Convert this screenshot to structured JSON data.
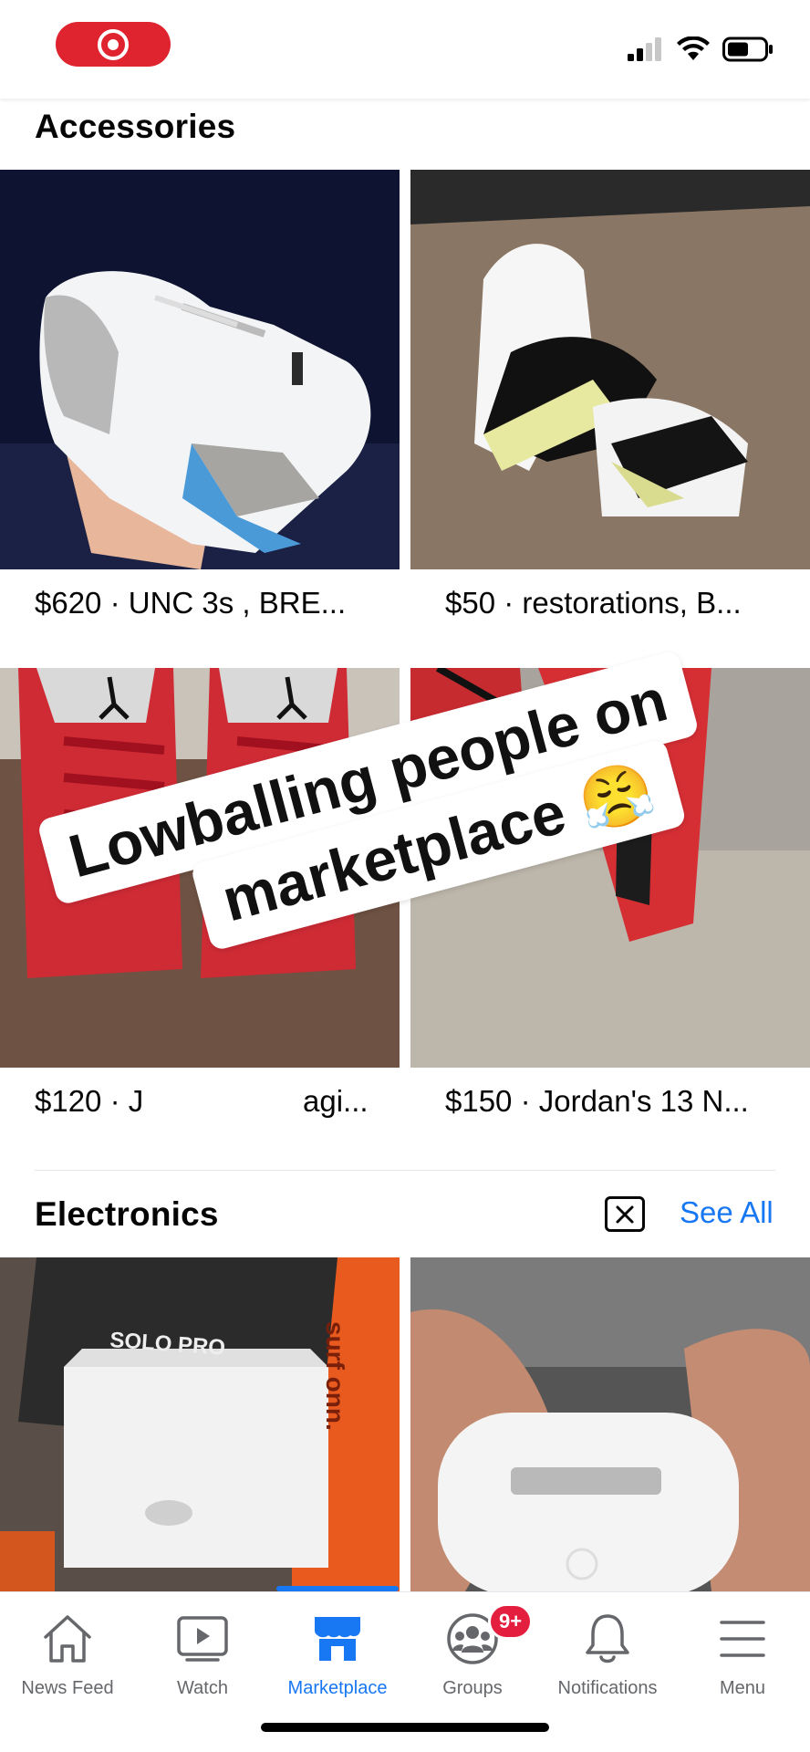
{
  "sections": {
    "accessories_title": "Accessories",
    "electronics_title": "Electronics",
    "see_all": "See All"
  },
  "listings": [
    {
      "price_title": "$620 · UNC 3s , BRE..."
    },
    {
      "price_title": "$50 · restorations, B..."
    },
    {
      "price_title": "$120 · J"
    },
    {
      "price_title": "$150 · Jordan's 13 N..."
    }
  ],
  "listing3_tail": "agi...",
  "overlay": {
    "line1": "Lowballing people on",
    "line2": "marketplace",
    "emoji": "😤"
  },
  "product_text": {
    "box_brand": "SOLO PRO",
    "side_text": "surf onn."
  },
  "nav": {
    "items": [
      {
        "label": "News Feed"
      },
      {
        "label": "Watch"
      },
      {
        "label": "Marketplace",
        "active": true
      },
      {
        "label": "Groups",
        "badge": "9+"
      },
      {
        "label": "Notifications"
      },
      {
        "label": "Menu"
      }
    ]
  },
  "colors": {
    "accent": "#1877f2",
    "badge": "#e41e3f",
    "record": "#e0242f"
  }
}
